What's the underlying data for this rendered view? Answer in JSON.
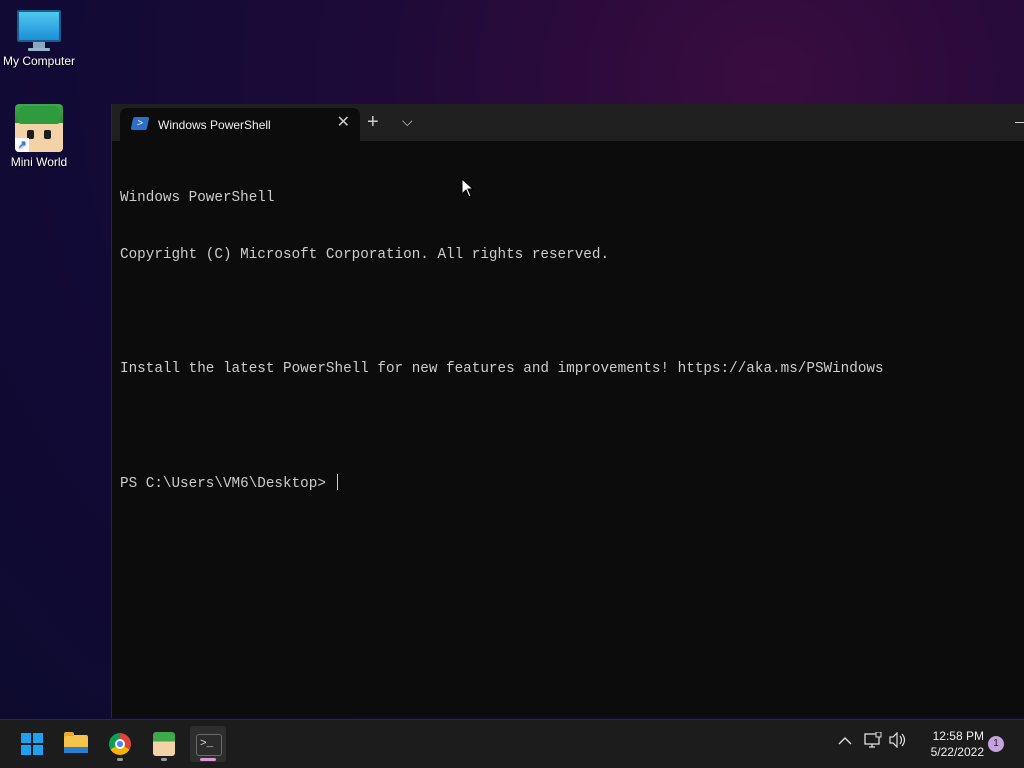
{
  "desktop": {
    "icons": [
      {
        "label": "My Computer",
        "icon": "monitor-icon"
      },
      {
        "label": "Mini World",
        "icon": "mini-world-game-icon"
      }
    ]
  },
  "terminal": {
    "tab_title": "Windows PowerShell",
    "tab_icon": "powershell-icon",
    "close_glyph": "✕",
    "new_tab_glyph": "+",
    "dropdown_glyph": "⌵",
    "console_lines": [
      "Windows PowerShell",
      "Copyright (C) Microsoft Corporation. All rights reserved.",
      "",
      "Install the latest PowerShell for new features and improvements! https://aka.ms/PSWindows",
      "",
      "PS C:\\Users\\VM6\\Desktop> "
    ],
    "colors": {
      "background": "#0c0c0c",
      "text": "#cccccc",
      "titlebar": "#202020"
    }
  },
  "taskbar": {
    "apps": [
      {
        "name": "start",
        "icon": "windows-logo-icon"
      },
      {
        "name": "file-explorer",
        "icon": "folder-icon"
      },
      {
        "name": "chrome",
        "icon": "chrome-icon"
      },
      {
        "name": "mini-world",
        "icon": "mini-world-game-icon"
      },
      {
        "name": "windows-terminal",
        "icon": "terminal-icon",
        "active": true
      }
    ],
    "tray": {
      "chevron_glyph": "^",
      "network_glyph": "🖧",
      "volume_glyph": "🔊",
      "time": "12:58 PM",
      "date": "5/22/2022",
      "notification_count": "1"
    }
  }
}
